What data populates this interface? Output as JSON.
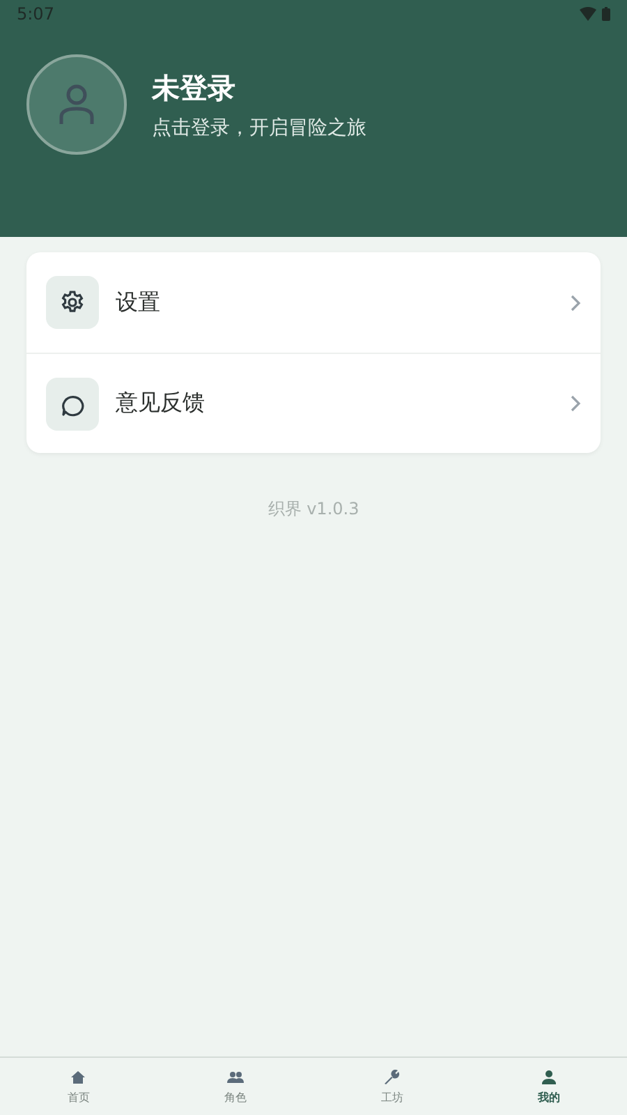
{
  "status_bar": {
    "time": "5:07"
  },
  "profile": {
    "name": "未登录",
    "subtitle": "点击登录，开启冒险之旅"
  },
  "menu": [
    {
      "kind": "settings",
      "label": "设置"
    },
    {
      "kind": "feedback",
      "label": "意见反馈"
    }
  ],
  "version": "织界 v1.0.3",
  "bottom_nav": [
    {
      "kind": "home",
      "label": "首页",
      "selected": false
    },
    {
      "kind": "people",
      "label": "角色",
      "selected": false
    },
    {
      "kind": "wrench",
      "label": "工坊",
      "selected": false
    },
    {
      "kind": "person",
      "label": "我的",
      "selected": true
    }
  ]
}
